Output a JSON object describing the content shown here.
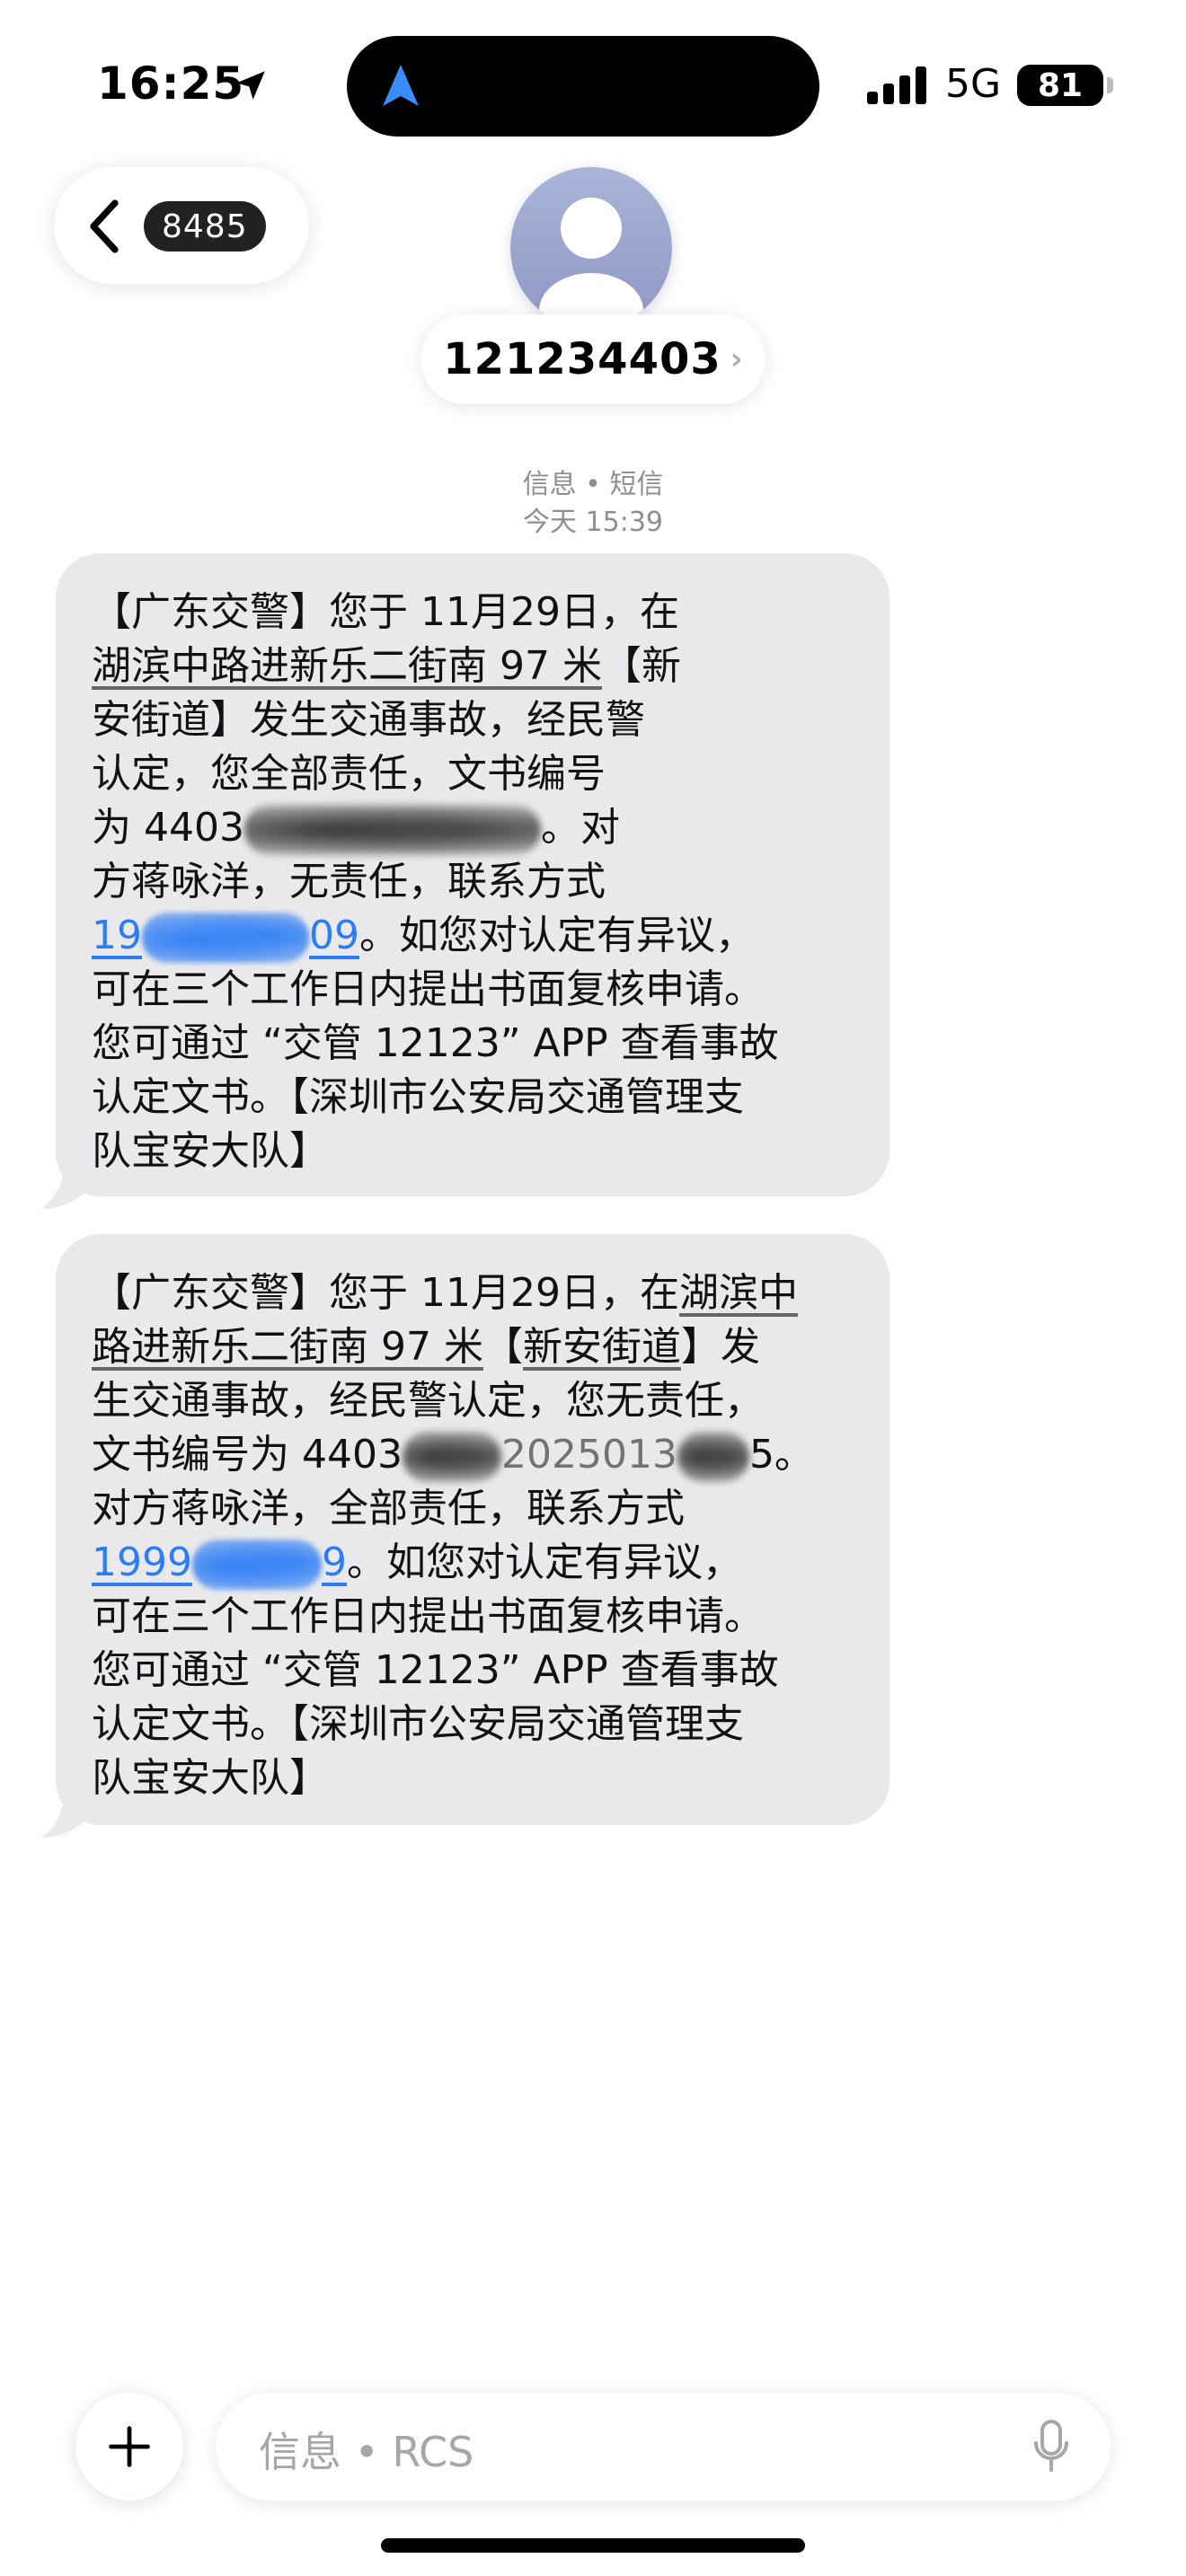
{
  "status_bar": {
    "time": "16:25",
    "network": "5G",
    "battery": "81"
  },
  "header": {
    "back_badge": "8485",
    "contact_name": "121234403",
    "contact_chevron": "›"
  },
  "conversation": {
    "service": "信息 • 短信",
    "timestamp": "今天 15:39"
  },
  "messages": [
    {
      "lines": [
        [
          "【广东交警】您于 11月29日，在"
        ],
        [
          "湖滨中路进新乐二街南 97 米",
          "【新"
        ],
        [
          "安街道",
          "】发生交通事故，经民警"
        ],
        [
          "认定，您全部责任，文书编号"
        ],
        [
          "为 4403",
          "。对"
        ],
        [
          "方蒋咏洋，无责任，联系方式"
        ],
        [
          "19",
          "09",
          "。如您对认定有异议，"
        ],
        [
          "可在三个工作日内提出书面复核申请。"
        ],
        [
          "您可通过 “交管 12123” APP 查看事故"
        ],
        [
          "认定文书。【深圳市公安局交通管理支"
        ],
        [
          "队宝安大队】"
        ]
      ]
    },
    {
      "lines": [
        [
          "【广东交警】您于 11月29日，在",
          "湖滨中"
        ],
        [
          "路进新乐二街南 97 米",
          "【",
          "新安街道",
          "】发"
        ],
        [
          "生交通事故，经民警认定，您无责任，"
        ],
        [
          "文书编号为 4403",
          "2025013",
          "5。"
        ],
        [
          "对方蒋咏洋，全部责任，联系方式"
        ],
        [
          "1999",
          "9",
          "。如您对认定有异议，"
        ],
        [
          "可在三个工作日内提出书面复核申请。"
        ],
        [
          "您可通过 “交管 12123” APP 查看事故"
        ],
        [
          "认定文书。【深圳市公安局交通管理支"
        ],
        [
          "队宝安大队】"
        ]
      ]
    }
  ],
  "composer": {
    "placeholder": "信息 • RCS"
  },
  "icons": {
    "location": "location-arrow-icon",
    "island": "navigation-arrow-icon",
    "signal": "cellular-signal-icon",
    "back": "chevron-left-icon",
    "avatar": "person-icon",
    "plus": "plus-icon",
    "mic": "microphone-icon"
  },
  "colors": {
    "bubble": "#e9e9eb",
    "link": "#2b7cf6",
    "island_arrow": "#3b8cf6"
  }
}
